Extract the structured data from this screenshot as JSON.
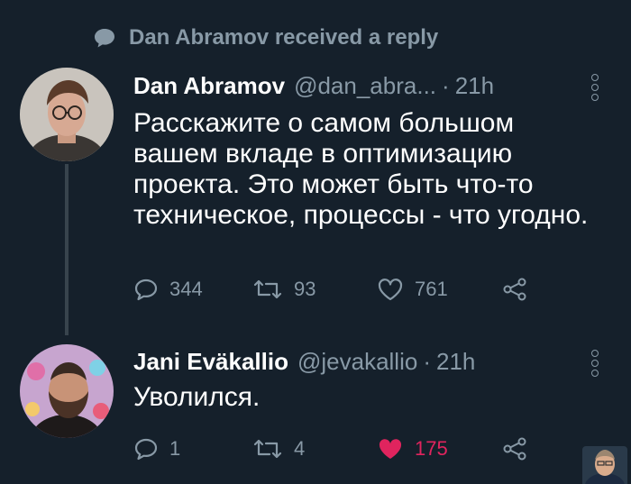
{
  "context": {
    "text": "Dan Abramov received a reply",
    "icon": "speech-bubble-icon"
  },
  "tweets": [
    {
      "name": "Dan Abramov",
      "handle": "@dan_abra...",
      "separator": "·",
      "time": "21h",
      "text": "Расскажите о самом большом вашем вкладе в оптимизацию проекта. Это может быть что-то техническое, процессы - что угодно.",
      "replies": "344",
      "retweets": "93",
      "likes": "761",
      "liked": false
    },
    {
      "name": "Jani Eväkallio",
      "handle": "@jevakallio",
      "separator": "·",
      "time": "21h",
      "text": "Уволился.",
      "replies": "1",
      "retweets": "4",
      "likes": "175",
      "liked": true
    }
  ],
  "colors": {
    "background": "#15202b",
    "muted": "#8899a6",
    "like": "#e0245e",
    "thread_line": "#38444d"
  }
}
